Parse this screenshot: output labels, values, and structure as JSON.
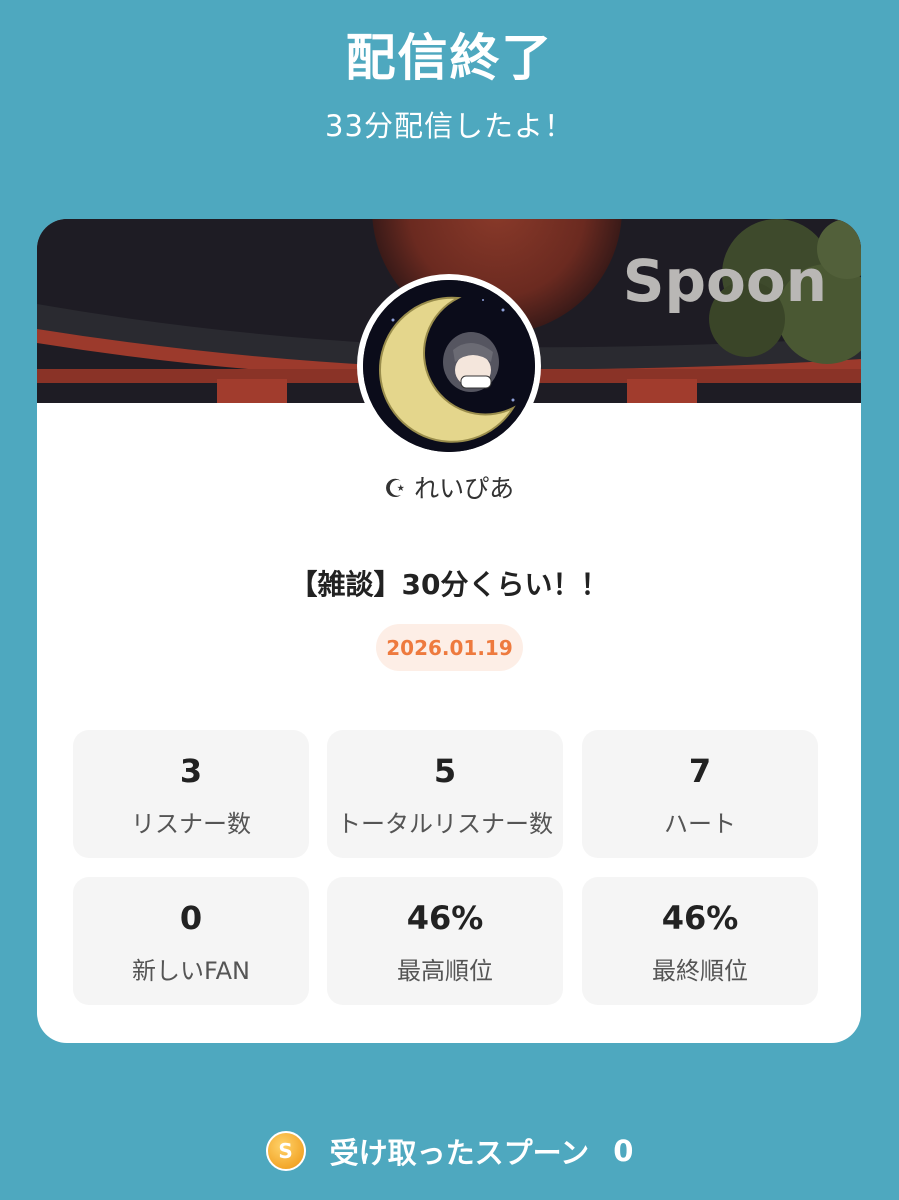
{
  "header": {
    "title": "配信終了",
    "subtitle": "33分配信したよ！"
  },
  "card": {
    "brand": "Spoon",
    "username": "☪︎ れいぴあ",
    "live_title": "【雑談】30分くらい！！",
    "date": "2026.01.19",
    "stats": [
      {
        "value": "3",
        "label": "リスナー数"
      },
      {
        "value": "5",
        "label": "トータルリスナー数"
      },
      {
        "value": "7",
        "label": "ハート"
      },
      {
        "value": "0",
        "label": "新しいFAN"
      },
      {
        "value": "46%",
        "label": "最高順位"
      },
      {
        "value": "46%",
        "label": "最終順位"
      }
    ]
  },
  "footer": {
    "coin_glyph": "S",
    "label": "受け取ったスプーン",
    "count": "0"
  },
  "colors": {
    "background": "#4ea8bf",
    "date_accent": "#ee7a3e",
    "coin": "#f3a72b"
  }
}
